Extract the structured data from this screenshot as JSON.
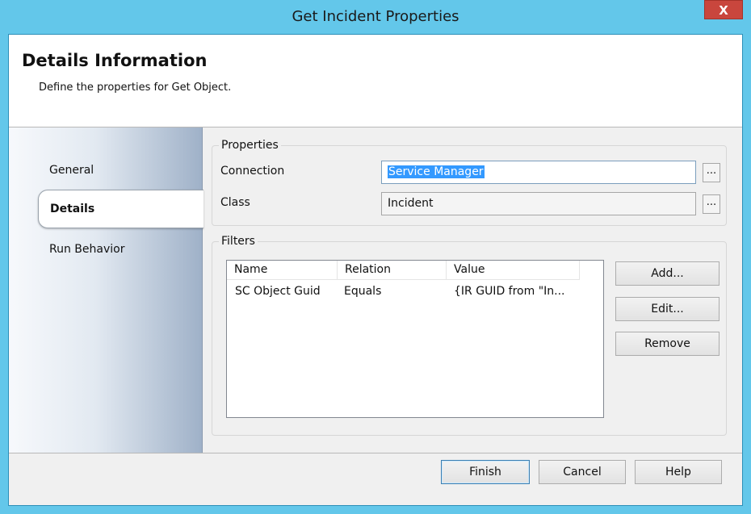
{
  "window": {
    "title": "Get Incident Properties",
    "close_label": "X"
  },
  "header": {
    "title": "Details Information",
    "subtitle": "Define the properties for Get Object."
  },
  "nav": {
    "items": [
      "General",
      "Details",
      "Run Behavior"
    ],
    "active": "Details"
  },
  "properties": {
    "legend": "Properties",
    "connection_label": "Connection",
    "connection_value": "Service Manager",
    "class_label": "Class",
    "class_value": "Incident",
    "browse_label": "..."
  },
  "filters": {
    "legend": "Filters",
    "columns": [
      "Name",
      "Relation",
      "Value"
    ],
    "rows": [
      {
        "name": "SC Object Guid",
        "relation": "Equals",
        "value": "{IR GUID from \"In..."
      }
    ],
    "buttons": {
      "add": "Add...",
      "edit": "Edit...",
      "remove": "Remove"
    }
  },
  "footer": {
    "finish": "Finish",
    "cancel": "Cancel",
    "help": "Help"
  }
}
